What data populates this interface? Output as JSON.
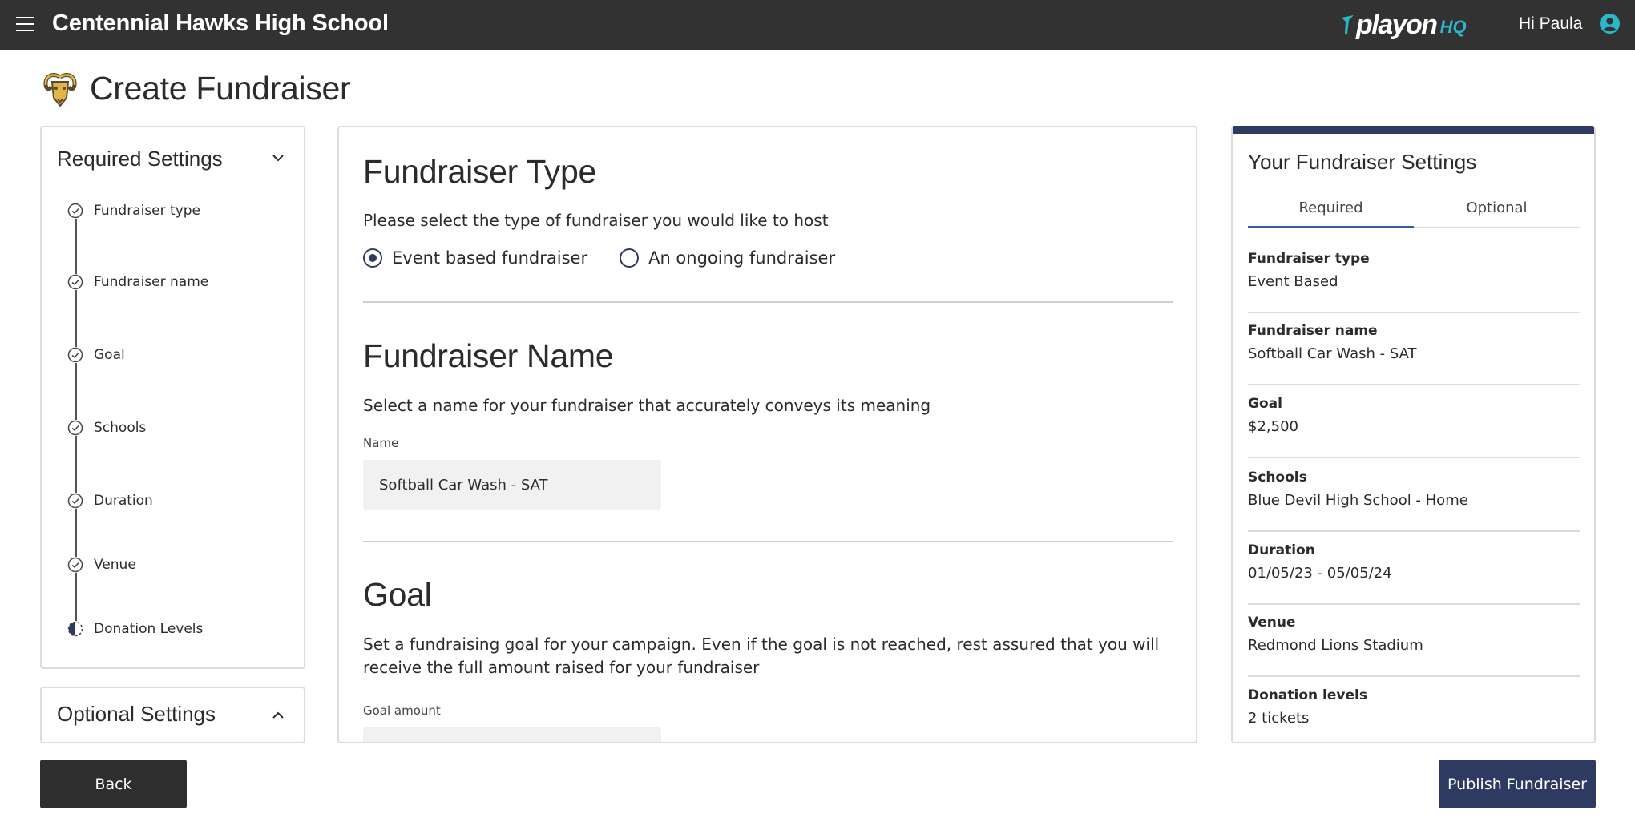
{
  "header": {
    "menu_icon": "hamburger-menu-icon",
    "school_name": "Centennial Hawks High School",
    "logo_text": "playon",
    "logo_suffix": "HQ",
    "greeting": "Hi Paula",
    "account_icon": "user-account-icon"
  },
  "page": {
    "title": "Create Fundraiser",
    "mascot_icon": "ram-mascot-logo"
  },
  "sidebar": {
    "required_title": "Required Settings",
    "optional_title": "Optional Settings",
    "steps": [
      {
        "label": "Fundraiser type",
        "status": "complete"
      },
      {
        "label": "Fundraiser name",
        "status": "complete"
      },
      {
        "label": "Goal",
        "status": "complete"
      },
      {
        "label": "Schools",
        "status": "complete"
      },
      {
        "label": "Duration",
        "status": "complete"
      },
      {
        "label": "Venue",
        "status": "complete"
      },
      {
        "label": "Donation Levels",
        "status": "in-progress"
      }
    ]
  },
  "main": {
    "type_section": {
      "title": "Fundraiser Type",
      "description": "Please select the type of fundraiser you would like to host",
      "options": [
        {
          "label": "Event based fundraiser",
          "selected": true
        },
        {
          "label": "An ongoing fundraiser",
          "selected": false
        }
      ]
    },
    "name_section": {
      "title": "Fundraiser Name",
      "description": "Select a name for your fundraiser that accurately conveys its meaning",
      "field_label": "Name",
      "field_value": "Softball Car Wash - SAT"
    },
    "goal_section": {
      "title": "Goal",
      "description": "Set a fundraising goal for your campaign. Even if the goal is not reached, rest assured that you will receive the full amount raised for your fundraiser",
      "field_label": "Goal amount"
    }
  },
  "summary": {
    "title": "Your Fundraiser Settings",
    "tabs": [
      "Required",
      "Optional"
    ],
    "active_tab": "Required",
    "items": [
      {
        "label": "Fundraiser type",
        "value": "Event Based"
      },
      {
        "label": "Fundraiser name",
        "value": "Softball Car Wash - SAT"
      },
      {
        "label": "Goal",
        "value": "$2,500"
      },
      {
        "label": "Schools",
        "value": "Blue Devil High School - Home"
      },
      {
        "label": "Duration",
        "value": "01/05/23 - 05/05/24"
      },
      {
        "label": "Venue",
        "value": "Redmond Lions Stadium"
      },
      {
        "label": "Donation levels",
        "value": "2 tickets"
      }
    ]
  },
  "footer": {
    "back_label": "Back",
    "publish_label": "Publish Fundraiser"
  },
  "colors": {
    "topbar": "#323232",
    "accent_navy": "#2f3a62",
    "accent_teal": "#2bb7c9",
    "tab_underline": "#3c5aa6"
  }
}
